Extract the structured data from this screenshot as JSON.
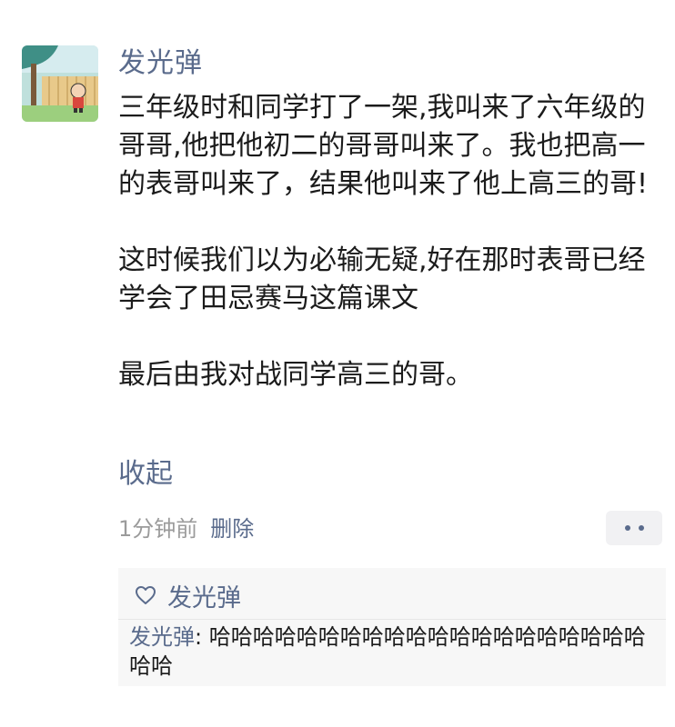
{
  "post": {
    "username": "发光弹",
    "paragraphs": [
      "三年级时和同学打了一架,我叫来了六年级的哥哥,他把他初二的哥哥叫来了。我也把高一的表哥叫来了，结果他叫来了他上高三的哥!",
      "这时候我们以为必输无疑,好在那时表哥已经学会了田忌赛马这篇课文",
      "最后由我对战同学高三的哥。"
    ],
    "collapse_label": "收起",
    "time": "1分钟前",
    "delete_label": "删除",
    "more_icon": "more-dots-icon"
  },
  "interactions": {
    "likes": {
      "icon": "heart-outline-icon",
      "names": "发光弹"
    },
    "comments": [
      {
        "author": "发光弹",
        "separator": ": ",
        "text": "哈哈哈哈哈哈哈哈哈哈哈哈哈哈哈哈哈哈哈哈哈哈"
      }
    ]
  },
  "colors": {
    "name_link": "#5a6b8c",
    "meta_gray": "#9b9b9b",
    "comment_bg": "#f7f7f7"
  }
}
